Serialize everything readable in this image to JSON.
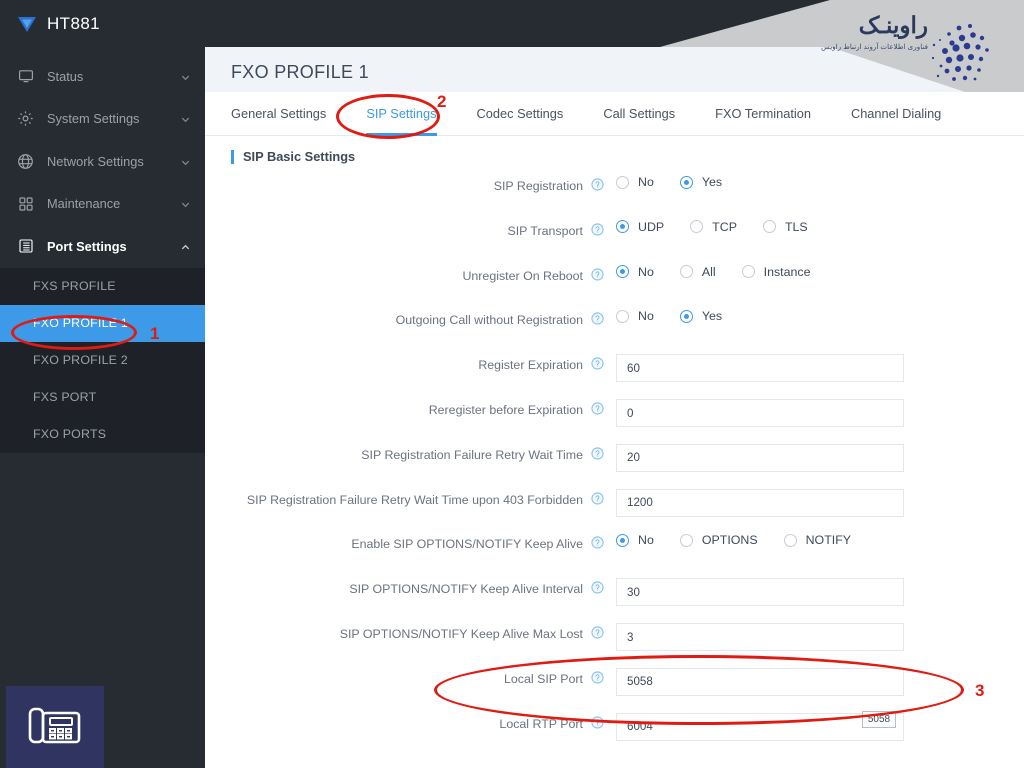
{
  "brand": {
    "name": "HT881",
    "logo_icon": "play-triangle-logo-icon"
  },
  "sidebar": {
    "items": [
      {
        "label": "Status",
        "icon": "monitor-icon",
        "chevron": "chevron-down-icon",
        "expanded": false
      },
      {
        "label": "System Settings",
        "icon": "gear-icon",
        "chevron": "chevron-down-icon",
        "expanded": false
      },
      {
        "label": "Network Settings",
        "icon": "globe-icon",
        "chevron": "chevron-down-icon",
        "expanded": false
      },
      {
        "label": "Maintenance",
        "icon": "grid-squares-icon",
        "chevron": "chevron-down-icon",
        "expanded": false
      },
      {
        "label": "Port Settings",
        "icon": "server-list-icon",
        "chevron": "chevron-up-icon",
        "expanded": true
      }
    ],
    "subitems": [
      {
        "label": "FXS PROFILE",
        "active": false
      },
      {
        "label": "FXO PROFILE 1",
        "active": true
      },
      {
        "label": "FXO PROFILE 2",
        "active": false
      },
      {
        "label": "FXS PORT",
        "active": false
      },
      {
        "label": "FXO PORTS",
        "active": false
      }
    ],
    "phone_badge_icon": "desk-phone-icon"
  },
  "watermark": {
    "main_text": "راوینـک",
    "sub_text": "فناوری اطلاعات آروند ارتباط راویس",
    "dots_icon": "dot-cluster-icon"
  },
  "header": {
    "page_title": "FXO PROFILE 1"
  },
  "tabs": [
    {
      "label": "General Settings",
      "active": false
    },
    {
      "label": "SIP Settings",
      "active": true
    },
    {
      "label": "Codec Settings",
      "active": false
    },
    {
      "label": "Call Settings",
      "active": false
    },
    {
      "label": "FXO Termination",
      "active": false
    },
    {
      "label": "Channel Dialing",
      "active": false
    }
  ],
  "section": {
    "title": "SIP Basic Settings"
  },
  "help_icon": "question-circle-icon",
  "form": {
    "rows": [
      {
        "type": "radio",
        "label": "SIP Registration",
        "options": [
          {
            "label": "No",
            "selected": false
          },
          {
            "label": "Yes",
            "selected": true
          }
        ]
      },
      {
        "type": "radio",
        "label": "SIP Transport",
        "options": [
          {
            "label": "UDP",
            "selected": true
          },
          {
            "label": "TCP",
            "selected": false
          },
          {
            "label": "TLS",
            "selected": false
          }
        ]
      },
      {
        "type": "radio",
        "label": "Unregister On Reboot",
        "options": [
          {
            "label": "No",
            "selected": true
          },
          {
            "label": "All",
            "selected": false
          },
          {
            "label": "Instance",
            "selected": false
          }
        ]
      },
      {
        "type": "radio",
        "label": "Outgoing Call without Registration",
        "options": [
          {
            "label": "No",
            "selected": false
          },
          {
            "label": "Yes",
            "selected": true
          }
        ]
      },
      {
        "type": "text",
        "label": "Register Expiration",
        "value": "60"
      },
      {
        "type": "text",
        "label": "Reregister before Expiration",
        "value": "0"
      },
      {
        "type": "text",
        "label": "SIP Registration Failure Retry Wait Time",
        "value": "20"
      },
      {
        "type": "text",
        "label": "SIP Registration Failure Retry Wait Time upon 403 Forbidden",
        "value": "1200"
      },
      {
        "type": "radio",
        "label": "Enable SIP OPTIONS/NOTIFY Keep Alive",
        "options": [
          {
            "label": "No",
            "selected": true
          },
          {
            "label": "OPTIONS",
            "selected": false
          },
          {
            "label": "NOTIFY",
            "selected": false
          }
        ]
      },
      {
        "type": "text",
        "label": "SIP OPTIONS/NOTIFY Keep Alive Interval",
        "value": "30"
      },
      {
        "type": "text",
        "label": "SIP OPTIONS/NOTIFY Keep Alive Max Lost",
        "value": "3"
      },
      {
        "type": "text",
        "label": "Local SIP Port",
        "value": "5058"
      },
      {
        "type": "text",
        "label": "Local RTP Port",
        "value": "6004"
      }
    ]
  },
  "tooltip": {
    "text": "5058"
  },
  "annotations": [
    {
      "number": "1",
      "target": "sidebar-item-fxo-profile-1"
    },
    {
      "number": "2",
      "target": "tab-sip-settings"
    },
    {
      "number": "3",
      "target": "local-sip-port-field"
    }
  ],
  "colors": {
    "sidebar_bg": "#272c33",
    "subnav_bg": "#1e2228",
    "accent_blue": "#3d9ae8",
    "annotation_red": "#e01b12",
    "phone_badge_bg": "#2f3560"
  }
}
